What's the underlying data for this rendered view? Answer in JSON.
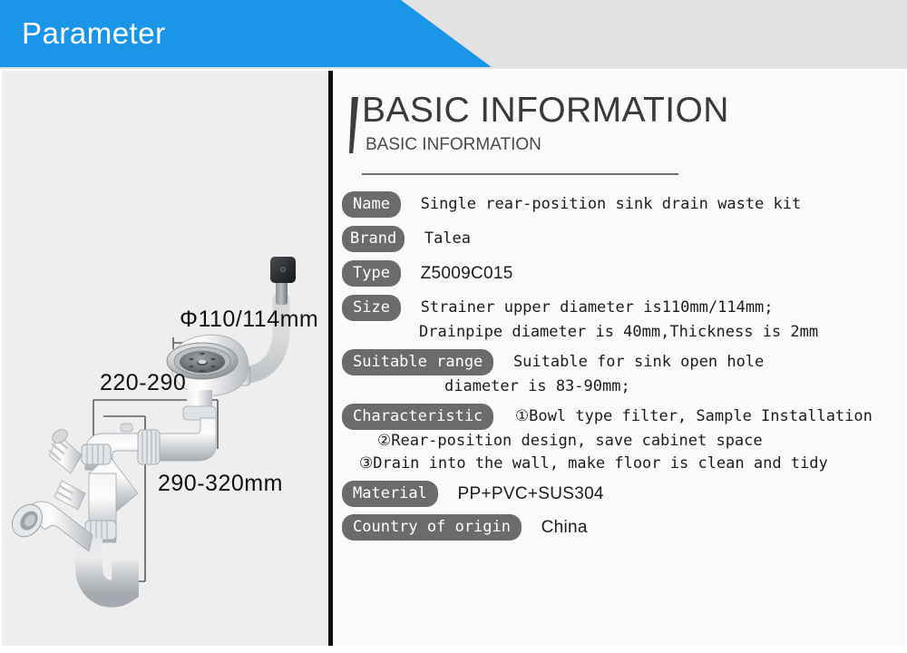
{
  "banner": {
    "title": "Parameter",
    "accent_color": "#1a96e8"
  },
  "heading": {
    "main": "BASIC INFORMATION",
    "sub": "BASIC INFORMATION"
  },
  "specs": {
    "name": {
      "label": "Name",
      "value": "Single rear-position sink drain waste kit"
    },
    "brand": {
      "label": "Brand",
      "value": "Talea"
    },
    "type": {
      "label": "Type",
      "value": "Z5009C015"
    },
    "size": {
      "label": "Size",
      "value": "Strainer upper diameter is110mm/114mm;",
      "line2": "Drainpipe diameter is 40mm,Thickness is 2mm"
    },
    "suitable_range": {
      "label": "Suitable range",
      "value": "Suitable for sink open hole",
      "line2": "diameter is 83-90mm;"
    },
    "characteristic": {
      "label": "Characteristic",
      "line1": "①Bowl type filter, Sample Installation",
      "line2": "②Rear-position design, save cabinet space",
      "line3": "③Drain into the wall, make floor is clean and tidy"
    },
    "material": {
      "label": "Material",
      "value": "PP+PVC+SUS304"
    },
    "country": {
      "label": "Country of origin",
      "value": "China"
    }
  },
  "product_image": {
    "dimension_diameter": "Φ110/114mm",
    "dimension_width": "220-290",
    "dimension_height": "290-320mm"
  }
}
